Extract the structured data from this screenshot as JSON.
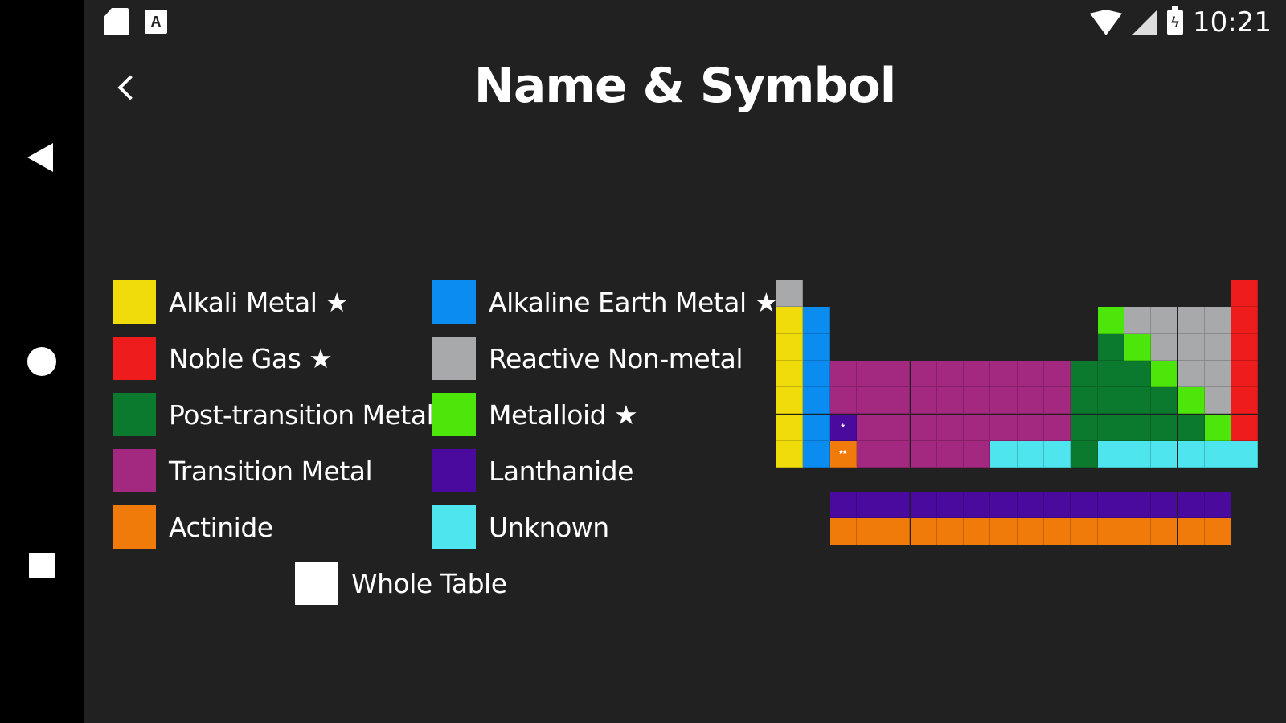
{
  "status_bar": {
    "left_icons": [
      "sd-card-icon",
      "font-a-icon"
    ],
    "right_icons": [
      "wifi-icon",
      "signal-icon",
      "battery-charging-icon"
    ],
    "time": "10:21"
  },
  "header": {
    "title": "Name & Symbol",
    "back_icon": "chevron-left-icon"
  },
  "legend": [
    {
      "key": "alkali",
      "label": "Alkali Metal ★",
      "color": "#F0DC0A"
    },
    {
      "key": "alkaline",
      "label": "Alkaline Earth Metal ★",
      "color": "#0A8CF0"
    },
    {
      "key": "noble",
      "label": "Noble Gas ★",
      "color": "#EE1C1C"
    },
    {
      "key": "nonmetal",
      "label": "Reactive Non-metal",
      "color": "#A7A9AB"
    },
    {
      "key": "post",
      "label": "Post-transition Metal",
      "color": "#0B7A2E"
    },
    {
      "key": "metalloid",
      "label": "Metalloid ★",
      "color": "#4CE60A"
    },
    {
      "key": "transition",
      "label": "Transition Metal",
      "color": "#A3287F"
    },
    {
      "key": "lanthanide",
      "label": "Lanthanide",
      "color": "#4A0A9E"
    },
    {
      "key": "actinide",
      "label": "Actinide",
      "color": "#F07A0A"
    },
    {
      "key": "unknown",
      "label": "Unknown",
      "color": "#4FE5EE"
    },
    {
      "key": "whole",
      "label": "Whole Table",
      "color": "#FFFFFF"
    }
  ],
  "periodic_table": {
    "lanthanide_marker": "*",
    "actinide_marker": "**",
    "rows": [
      [
        "N",
        "",
        "",
        "",
        "",
        "",
        "",
        "",
        "",
        "",
        "",
        "",
        "",
        "",
        "",
        "",
        "",
        "G"
      ],
      [
        "A",
        "E",
        "",
        "",
        "",
        "",
        "",
        "",
        "",
        "",
        "",
        "",
        "M",
        "N",
        "N",
        "N",
        "N",
        "G"
      ],
      [
        "A",
        "E",
        "",
        "",
        "",
        "",
        "",
        "",
        "",
        "",
        "",
        "",
        "P",
        "M",
        "N",
        "N",
        "N",
        "G"
      ],
      [
        "A",
        "E",
        "T",
        "T",
        "T",
        "T",
        "T",
        "T",
        "T",
        "T",
        "T",
        "P",
        "P",
        "P",
        "M",
        "N",
        "N",
        "G"
      ],
      [
        "A",
        "E",
        "T",
        "T",
        "T",
        "T",
        "T",
        "T",
        "T",
        "T",
        "T",
        "P",
        "P",
        "P",
        "P",
        "M",
        "N",
        "G"
      ],
      [
        "A",
        "E",
        "L",
        "T",
        "T",
        "T",
        "T",
        "T",
        "T",
        "T",
        "T",
        "P",
        "P",
        "P",
        "P",
        "P",
        "M",
        "G"
      ],
      [
        "A",
        "E",
        "C",
        "T",
        "T",
        "T",
        "T",
        "T",
        "U",
        "U",
        "U",
        "P",
        "U",
        "U",
        "U",
        "U",
        "U",
        "U"
      ]
    ],
    "lanthanide_row": [
      "L",
      "L",
      "L",
      "L",
      "L",
      "L",
      "L",
      "L",
      "L",
      "L",
      "L",
      "L",
      "L",
      "L",
      "L"
    ],
    "actinide_row": [
      "C",
      "C",
      "C",
      "C",
      "C",
      "C",
      "C",
      "C",
      "C",
      "C",
      "C",
      "C",
      "C",
      "C",
      "C"
    ],
    "code_colors": {
      "A": "#F0DC0A",
      "E": "#0A8CF0",
      "G": "#EE1C1C",
      "N": "#A7A9AB",
      "P": "#0B7A2E",
      "M": "#4CE60A",
      "T": "#A3287F",
      "L": "#4A0A9E",
      "C": "#F07A0A",
      "U": "#4FE5EE"
    }
  }
}
